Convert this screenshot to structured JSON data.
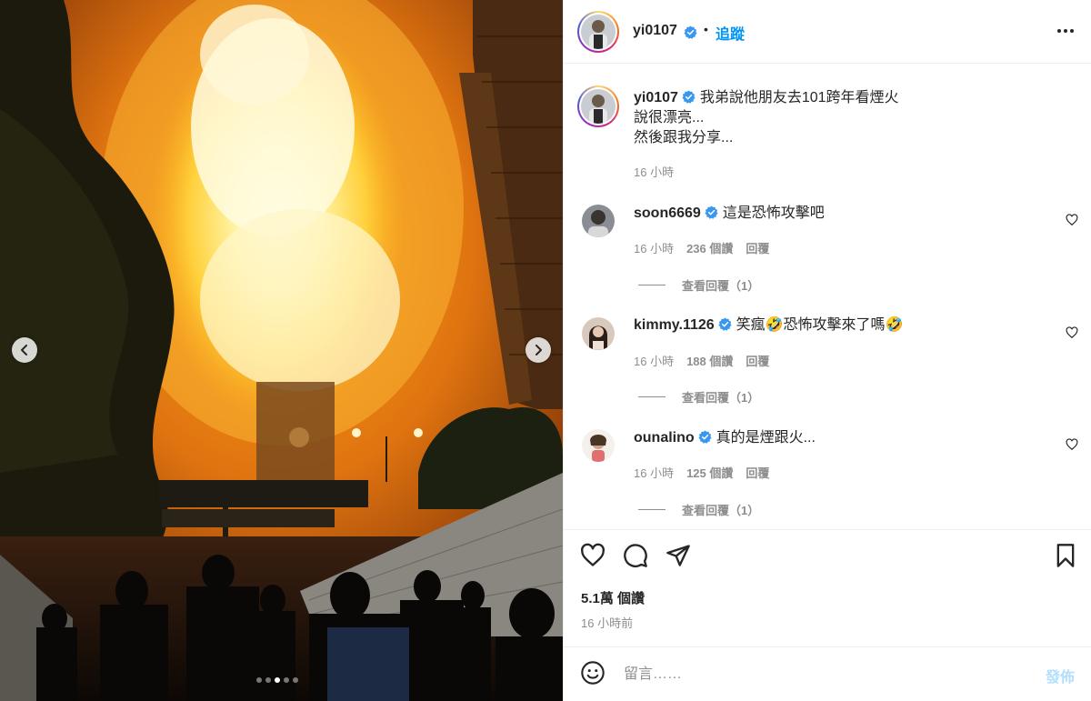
{
  "author": {
    "username": "yi0107",
    "follow_label": "追蹤"
  },
  "caption": {
    "username": "yi0107",
    "lines": [
      "我弟說他朋友去101跨年看煙火",
      "說很漂亮...",
      "然後跟我分享..."
    ],
    "time": "16 小時"
  },
  "comments": [
    {
      "username": "soon6669",
      "text": "這是恐怖攻擊吧",
      "time": "16 小時",
      "likes": "236 個讚",
      "reply_label": "回覆",
      "view_replies": "查看回覆（1）"
    },
    {
      "username": "kimmy.1126",
      "text": "笑瘋🤣恐怖攻擊來了嗎🤣",
      "time": "16 小時",
      "likes": "188 個讚",
      "reply_label": "回覆",
      "view_replies": "查看回覆（1）"
    },
    {
      "username": "ounalino",
      "text": "真的是煙跟火...",
      "time": "16 小時",
      "likes": "125 個讚",
      "reply_label": "回覆",
      "view_replies": "查看回覆（1）"
    }
  ],
  "stats": {
    "likes": "5.1萬 個讚",
    "time_ago": "16 小時前"
  },
  "comment_box": {
    "placeholder": "留言……",
    "post_label": "發佈"
  },
  "carousel": {
    "slide_count": 5,
    "active_slide": 3
  },
  "colors": {
    "link_blue": "#0095f6",
    "verified_blue": "#3897f0",
    "muted": "#8e8e8e",
    "post_disabled": "#b3dffc"
  },
  "icons": {
    "verified": "verified-badge-icon",
    "more": "more-options-icon",
    "like": "heart-icon",
    "comment": "comment-icon",
    "share": "paper-plane-icon",
    "save": "bookmark-icon",
    "emoji": "emoji-icon",
    "prev": "chevron-left-icon",
    "next": "chevron-right-icon"
  }
}
